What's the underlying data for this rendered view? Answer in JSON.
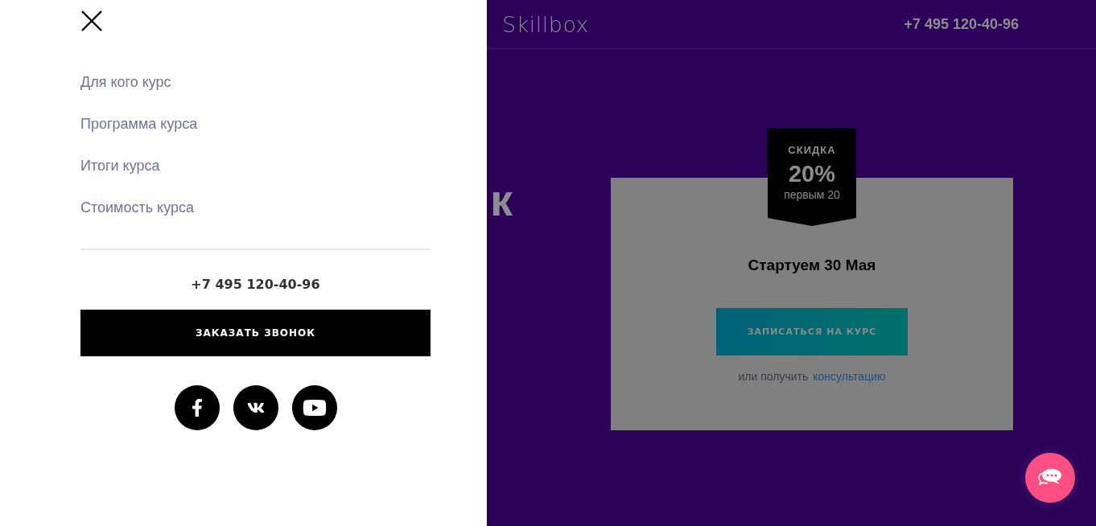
{
  "drawer": {
    "nav_items": [
      "Для кого курс",
      "Программа курса",
      "Итоги курса",
      "Стоимость курса"
    ],
    "phone": "+7 495 120-40-96",
    "call_button": "ЗАКАЗАТЬ ЗВОНОК",
    "socials": [
      {
        "kind": "facebook"
      },
      {
        "kind": "vk"
      },
      {
        "kind": "youtube"
      }
    ]
  },
  "page": {
    "logo": "Skillbox",
    "phone": "+7 495 120-40-96",
    "hero_title_fragment": "к",
    "card": {
      "badge": {
        "title": "СКИДКА",
        "value": "20%",
        "note": "первым 20"
      },
      "start": "Стартуем 30 Мая",
      "enroll_button": "ЗАПИСАТЬСЯ НА КУРС",
      "alt_text": "или получить",
      "alt_link": "консультацию"
    }
  }
}
